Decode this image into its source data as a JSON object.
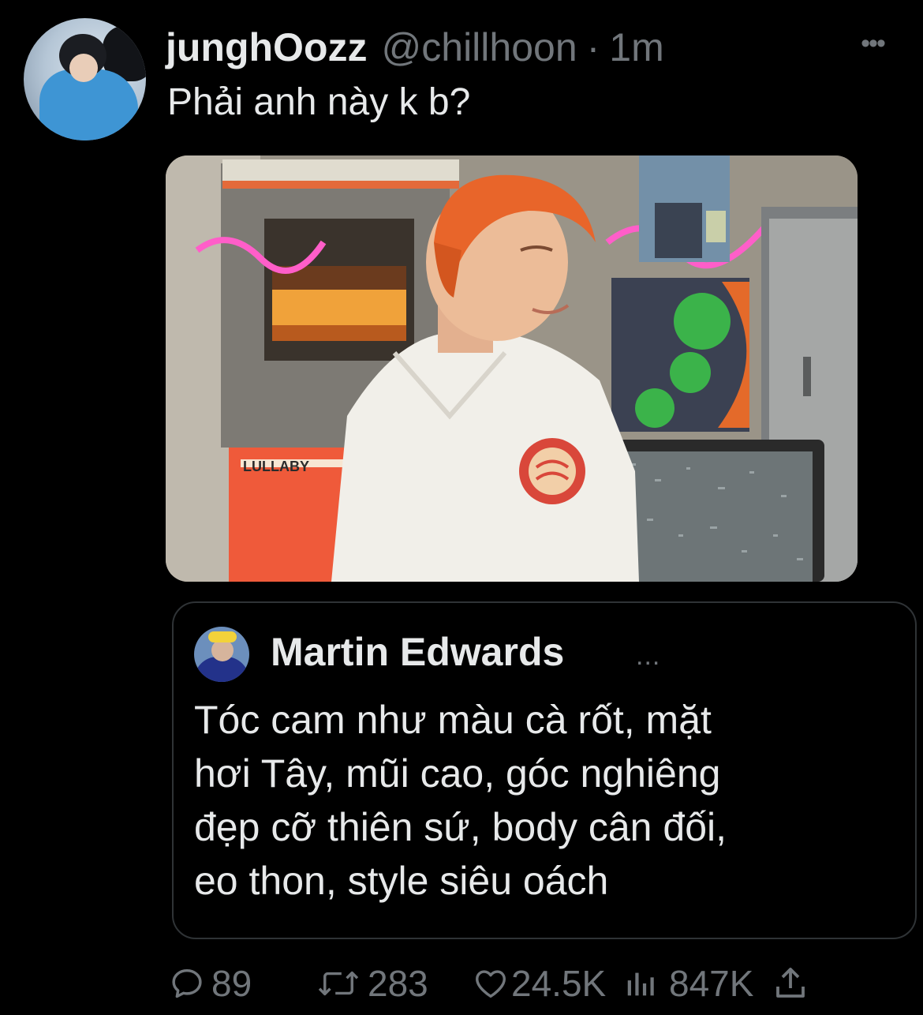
{
  "tweet": {
    "display_name": "junghOozz",
    "handle": "@chillhoon",
    "separator": "·",
    "time": "1m",
    "more_label": "•••",
    "text": "Phải anh này k b?",
    "media_poster_label": "LULLABY"
  },
  "quote": {
    "display_name": "Martin Edwards",
    "more_label": "...",
    "text_lines": [
      "Tóc cam như màu cà rốt, mặt",
      "hơi Tây, mũi cao, góc nghiêng",
      "đẹp cỡ thiên sứ, body cân đối,",
      "eo thon, style siêu oách"
    ]
  },
  "actions": {
    "replies": "89",
    "retweets": "283",
    "likes": "24.5K",
    "views": "847K"
  },
  "icons": {
    "reply": "reply-bubble-icon",
    "retweet": "retweet-arrows-icon",
    "like": "heart-icon",
    "views": "bar-chart-icon",
    "share": "share-upload-icon"
  },
  "colors": {
    "background": "#000000",
    "primary_text": "#e7e9ea",
    "secondary_text": "#71767b",
    "border": "#2f3336"
  }
}
